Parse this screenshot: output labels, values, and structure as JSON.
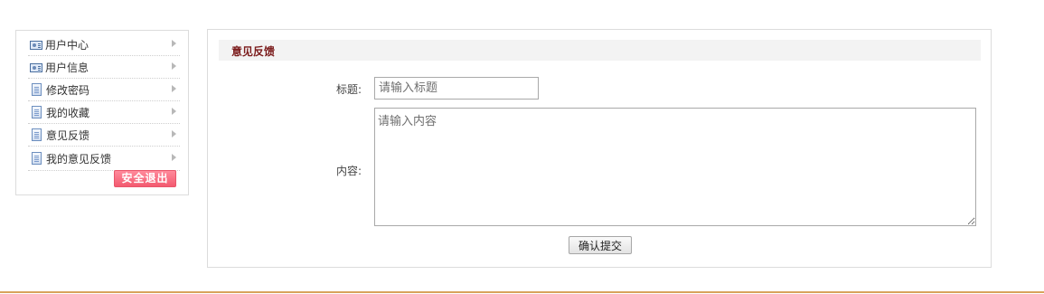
{
  "sidebar": {
    "items": [
      {
        "label": "用户中心",
        "icon": "user-card-icon"
      },
      {
        "label": "用户信息",
        "icon": "user-card-icon"
      },
      {
        "label": "修改密码",
        "icon": "document-icon"
      },
      {
        "label": "我的收藏",
        "icon": "document-icon"
      },
      {
        "label": "意见反馈",
        "icon": "document-icon"
      },
      {
        "label": "我的意见反馈",
        "icon": "document-icon"
      }
    ],
    "logout_label": "安全退出"
  },
  "main": {
    "title": "意见反馈",
    "form": {
      "title_label": "标题:",
      "title_placeholder": "请输入标题",
      "title_value": "",
      "content_label": "内容:",
      "content_placeholder": "请输入内容",
      "content_value": "",
      "submit_label": "确认提交"
    }
  },
  "colors": {
    "logout_button": "#f35a70",
    "section_title": "#7a1a1a",
    "footer_line": "#d8a35b",
    "header_bg": "#f3f3f3"
  }
}
